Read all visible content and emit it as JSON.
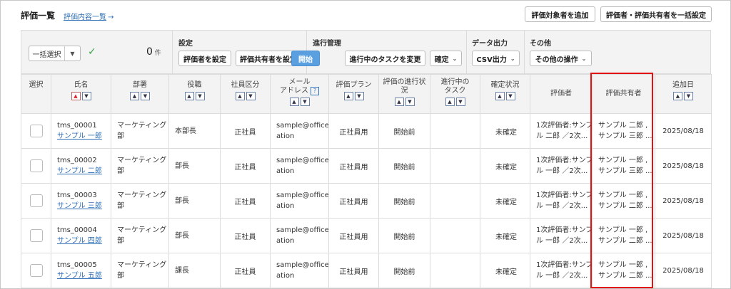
{
  "header": {
    "title": "評価一覧",
    "link": "評価内容一覧",
    "add_target_button": "評価対象者を追加",
    "bulk_setting_button": "評価者・評価共有者を一括設定"
  },
  "toolbar": {
    "bulk_select": "一括選択",
    "count": "0",
    "count_unit": "件",
    "settings": {
      "label": "設定",
      "evaluator_button": "評価者を設定",
      "sharer_button": "評価共有者を設定"
    },
    "progress": {
      "label": "進行管理",
      "start_button": "開始",
      "change_task_button": "進行中のタスクを変更",
      "confirm_button": "確定"
    },
    "export": {
      "label": "データ出力",
      "csv_button": "CSV出力"
    },
    "other": {
      "label": "その他",
      "ops_button": "その他の操作"
    }
  },
  "table": {
    "columns": {
      "select": "選択",
      "name": "氏名",
      "dept": "部署",
      "role": "役職",
      "emp_type": "社員区分",
      "mail_1": "メール",
      "mail_2": "アドレス",
      "plan": "評価プラン",
      "status_1": "評価の進行状",
      "status_2": "況",
      "task_1": "進行中の",
      "task_2": "タスク",
      "confirm": "確定状況",
      "evaluator": "評価者",
      "sharer": "評価共有者",
      "added": "追加日"
    },
    "rows": [
      {
        "id": "tms_00001",
        "name": "サンプル 一郎",
        "dept_1": "マーケティング",
        "dept_2": "部",
        "role": "本部長",
        "emp_type": "正社員",
        "mail_1": "sample@officest",
        "mail_2": "ation",
        "plan": "正社員用",
        "status": "開始前",
        "task": "",
        "confirm": "未確定",
        "evaluator_1": "1次評価者:サンプ",
        "evaluator_2": "ル 二郎 ／2次...",
        "sharer_1": "サンプル 二郎 ,",
        "sharer_2": "サンプル 三郎 ...",
        "added": "2025/08/18"
      },
      {
        "id": "tms_00002",
        "name": "サンプル 二郎",
        "dept_1": "マーケティング",
        "dept_2": "部",
        "role": "部長",
        "emp_type": "正社員",
        "mail_1": "sample@officest",
        "mail_2": "ation",
        "plan": "正社員用",
        "status": "開始前",
        "task": "",
        "confirm": "未確定",
        "evaluator_1": "1次評価者:サンプ",
        "evaluator_2": "ル 一郎 ／2次...",
        "sharer_1": "サンプル 一郎 ,",
        "sharer_2": "サンプル 三郎 ...",
        "added": "2025/08/18"
      },
      {
        "id": "tms_00003",
        "name": "サンプル 三郎",
        "dept_1": "マーケティング",
        "dept_2": "部",
        "role": "部長",
        "emp_type": "正社員",
        "mail_1": "sample@officest",
        "mail_2": "ation",
        "plan": "正社員用",
        "status": "開始前",
        "task": "",
        "confirm": "未確定",
        "evaluator_1": "1次評価者:サンプ",
        "evaluator_2": "ル 一郎 ／2次...",
        "sharer_1": "サンプル 一郎 ,",
        "sharer_2": "サンプル 二郎 ...",
        "added": "2025/08/18"
      },
      {
        "id": "tms_00004",
        "name": "サンプル 四郎",
        "dept_1": "マーケティング",
        "dept_2": "部",
        "role": "部長",
        "emp_type": "正社員",
        "mail_1": "sample@officest",
        "mail_2": "ation",
        "plan": "正社員用",
        "status": "開始前",
        "task": "",
        "confirm": "未確定",
        "evaluator_1": "1次評価者:サンプ",
        "evaluator_2": "ル 一郎 ／2次...",
        "sharer_1": "サンプル 一郎 ,",
        "sharer_2": "サンプル 二郎 ...",
        "added": "2025/08/18"
      },
      {
        "id": "tms_00005",
        "name": "サンプル 五郎",
        "dept_1": "マーケティング",
        "dept_2": "部",
        "role": "課長",
        "emp_type": "正社員",
        "mail_1": "sample@officest",
        "mail_2": "ation",
        "plan": "正社員用",
        "status": "開始前",
        "task": "",
        "confirm": "未確定",
        "evaluator_1": "1次評価者:サンプ",
        "evaluator_2": "ル 一郎 ／2次...",
        "sharer_1": "サンプル 一郎 ,",
        "sharer_2": "サンプル 二郎 ...",
        "added": "2025/08/18"
      }
    ]
  },
  "colors": {
    "link": "#2f6fb5",
    "primary_button": "#5aa0e0",
    "highlight_border": "#e01212",
    "check": "#3aa34a"
  },
  "icons": {
    "check": "check-icon",
    "sort_up": "sort-asc-icon",
    "sort_down": "sort-desc-icon",
    "dropdown": "chevron-down-icon",
    "help": "help-icon",
    "arrow": "arrow-right-icon"
  }
}
